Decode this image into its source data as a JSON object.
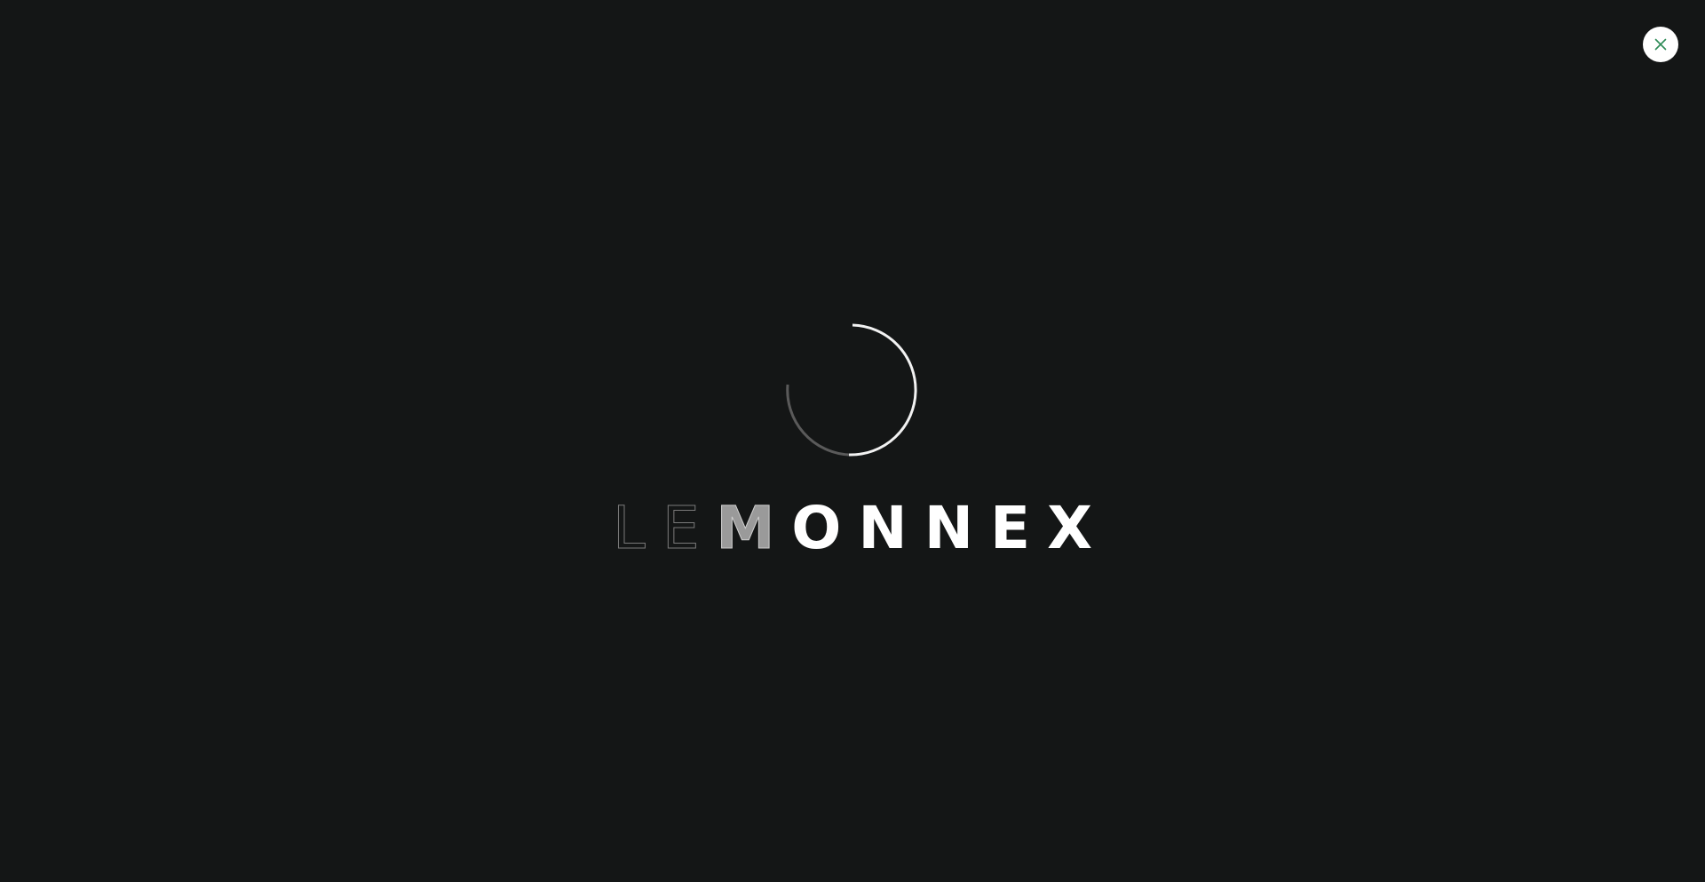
{
  "close": {
    "label": "Close",
    "icon": "close-icon",
    "icon_color": "#2e8b57"
  },
  "loader": {
    "icon": "loading-spinner-icon"
  },
  "brand": {
    "letters": [
      "L",
      "E",
      "M",
      "O",
      "N",
      "N",
      "E",
      "X"
    ]
  },
  "colors": {
    "background": "#141616",
    "text": "#ffffff",
    "close_background": "#ffffff"
  }
}
